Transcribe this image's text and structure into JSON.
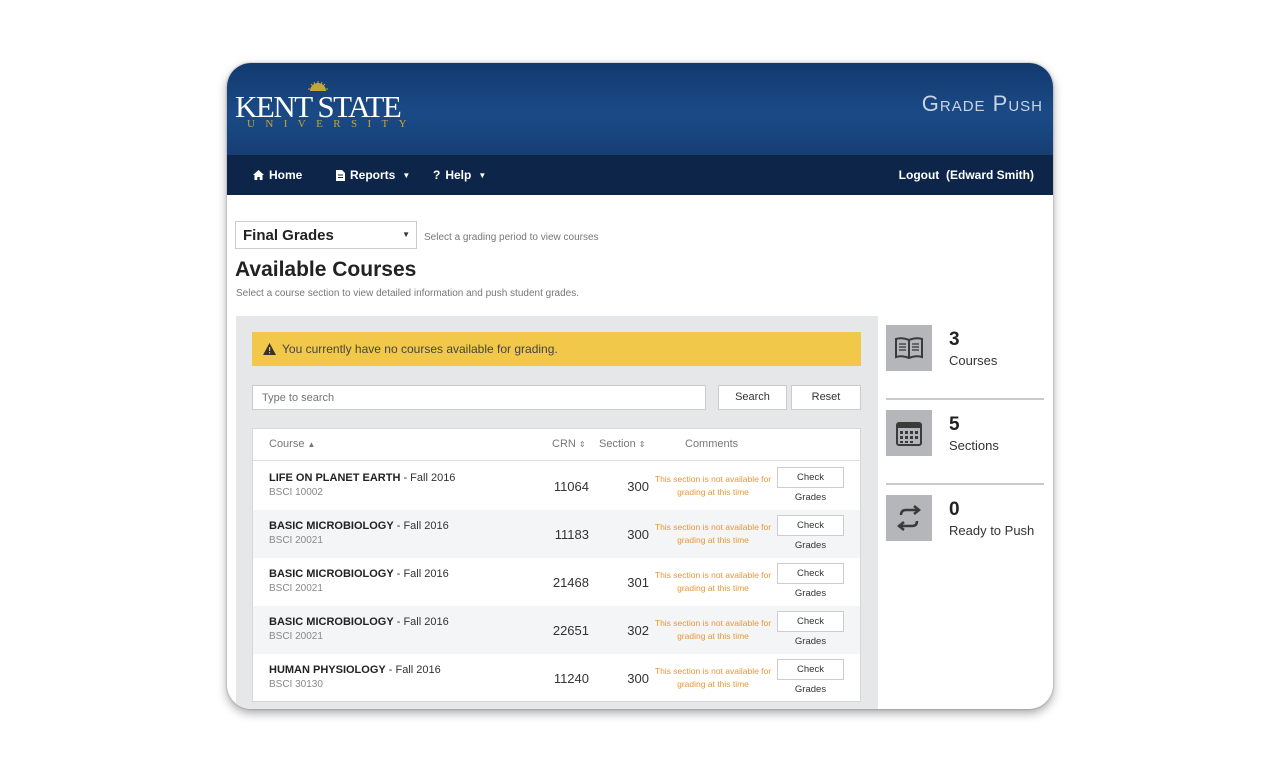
{
  "header": {
    "logo_main": "KENT STATE",
    "logo_sub": "UNIVERSITY",
    "app_title": "Grade Push"
  },
  "nav": {
    "home": "Home",
    "reports": "Reports",
    "help": "Help",
    "logout": "Logout",
    "user": "(Edward Smith)"
  },
  "period": {
    "selected": "Final Grades",
    "hint": "Select a grading period to view courses"
  },
  "page": {
    "title": "Available Courses",
    "subtitle": "Select a course section to view detailed information and push student grades."
  },
  "alert": {
    "message": "You currently have no courses available for grading."
  },
  "search": {
    "placeholder": "Type to search",
    "search_label": "Search",
    "reset_label": "Reset"
  },
  "table": {
    "columns": {
      "course": "Course",
      "crn": "CRN",
      "section": "Section",
      "comments": "Comments"
    },
    "rows": [
      {
        "name": "LIFE ON PLANET EARTH",
        "term": "- Fall 2016",
        "code": "BSCI 10002",
        "crn": "11064",
        "section": "300",
        "comment": "This section is not available for grading at this time",
        "check": "Check",
        "grades": "Grades"
      },
      {
        "name": "BASIC MICROBIOLOGY",
        "term": "- Fall 2016",
        "code": "BSCI 20021",
        "crn": "11183",
        "section": "300",
        "comment": "This section is not available for grading at this time",
        "check": "Check",
        "grades": "Grades"
      },
      {
        "name": "BASIC MICROBIOLOGY",
        "term": "- Fall 2016",
        "code": "BSCI 20021",
        "crn": "21468",
        "section": "301",
        "comment": "This section is not available for grading at this time",
        "check": "Check",
        "grades": "Grades"
      },
      {
        "name": "BASIC MICROBIOLOGY",
        "term": "- Fall 2016",
        "code": "BSCI 20021",
        "crn": "22651",
        "section": "302",
        "comment": "This section is not available for grading at this time",
        "check": "Check",
        "grades": "Grades"
      },
      {
        "name": "HUMAN PHYSIOLOGY",
        "term": "- Fall 2016",
        "code": "BSCI 30130",
        "crn": "11240",
        "section": "300",
        "comment": "This section is not available for grading at this time",
        "check": "Check",
        "grades": "Grades"
      }
    ]
  },
  "stats": [
    {
      "value": "3",
      "label": "Courses",
      "icon": "book-icon"
    },
    {
      "value": "5",
      "label": "Sections",
      "icon": "calendar-icon"
    },
    {
      "value": "0",
      "label": "Ready to Push",
      "icon": "sync-icon"
    }
  ],
  "colors": {
    "header_blue": "#1a4a86",
    "nav_navy": "#0c2549",
    "alert_yellow": "#f2c84b",
    "comment_orange": "#e8963a",
    "logo_gold": "#c5a43f"
  }
}
